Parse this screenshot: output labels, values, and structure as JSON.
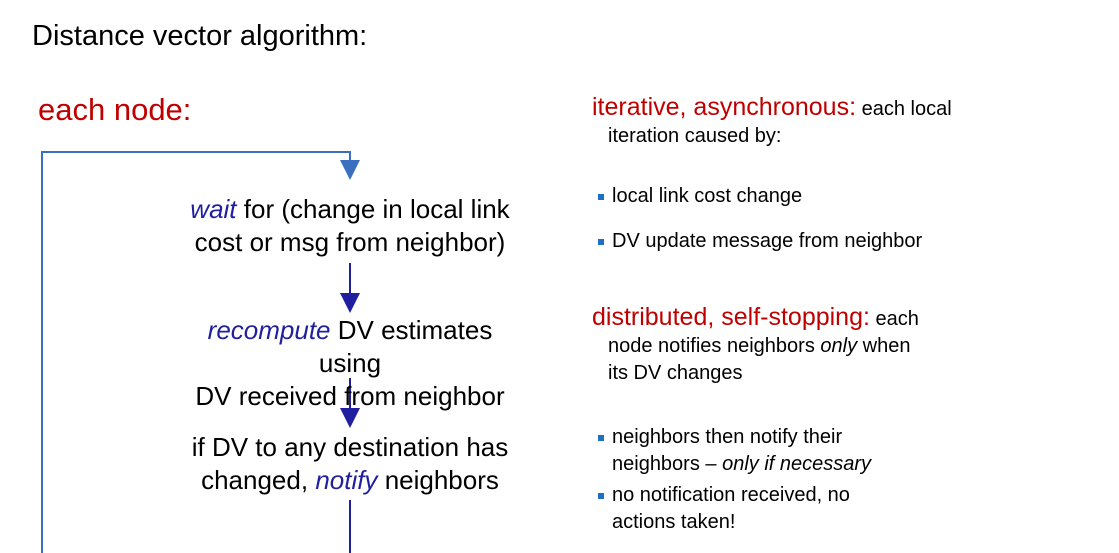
{
  "title": "Distance vector algorithm:",
  "each_node": "each node:",
  "flow": {
    "step1_em": "wait",
    "step1_line1": " for (change in local link",
    "step1_line2": "cost or msg from neighbor)",
    "step2_em": "recompute",
    "step2_line1": " DV estimates using",
    "step2_line2": "DV received from neighbor",
    "step3_line1": "if DV to any destination has",
    "step3_line2_a": "changed, ",
    "step3_em": "notify",
    "step3_line2_b": " neighbors"
  },
  "iterative": {
    "head": "iterative, asynchronous:",
    "text_a": " each local",
    "text_b": "iteration caused by:",
    "bullets": [
      "local link cost change",
      "DV update message from neighbor"
    ]
  },
  "distributed": {
    "head": "distributed, self-stopping:",
    "text_a": " each",
    "text_b1": "node notifies neighbors ",
    "text_b_em": "only",
    "text_b2": " when",
    "text_c": "its DV changes",
    "bullet1_a": "neighbors then notify their",
    "bullet1_b1": "neighbors – ",
    "bullet1_b_em": "only if necessary",
    "bullet2_a": "no notification received, no",
    "bullet2_b": "actions taken!"
  },
  "colors": {
    "accent_red": "#c00000",
    "emphasis_blue": "#1f1f9f",
    "loop_line": "#3b6fc0",
    "arrow": "#1f1f9f"
  }
}
